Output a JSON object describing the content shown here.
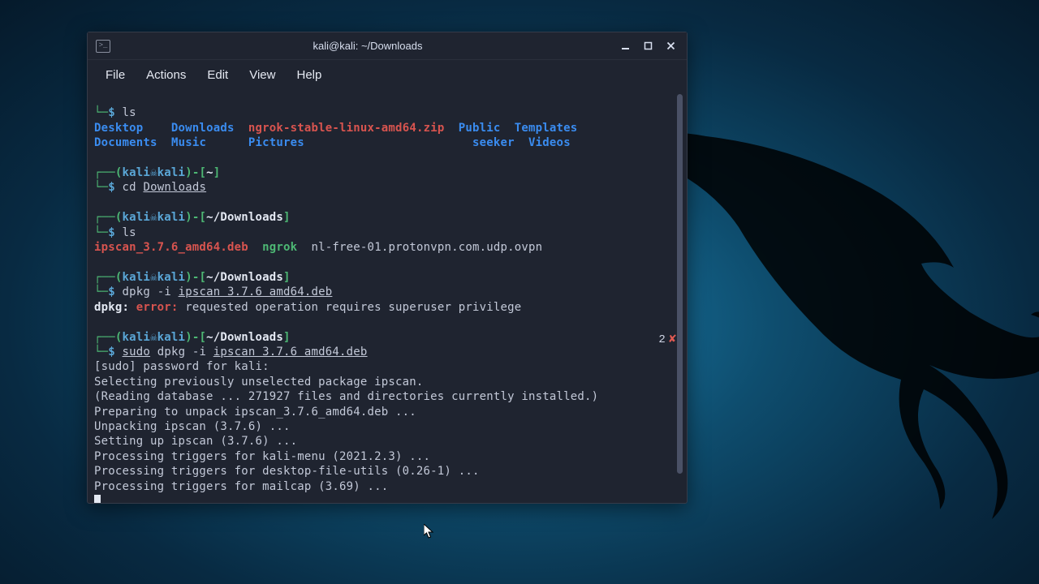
{
  "window": {
    "title": "kali@kali: ~/Downloads",
    "icon_glyph": ">_"
  },
  "menu": {
    "file": "File",
    "actions": "Actions",
    "edit": "Edit",
    "view": "View",
    "help": "Help"
  },
  "prompt": {
    "user": "kali",
    "host": "kali",
    "dollar": "$",
    "skull": "☠"
  },
  "block1": {
    "path": "~",
    "cmd": "ls",
    "listing": {
      "desktop": "Desktop",
      "downloads": "Downloads",
      "zip": "ngrok-stable-linux-amd64.zip",
      "public": "Public",
      "templates": "Templates",
      "documents": "Documents",
      "music": "Music",
      "pictures": "Pictures",
      "seeker": "seeker",
      "videos": "Videos"
    }
  },
  "block2": {
    "path": "~",
    "cmd_cd": "cd ",
    "cmd_arg": "Downloads"
  },
  "block3": {
    "path": "~/Downloads",
    "cmd": "ls",
    "deb": "ipscan_3.7.6_amd64.deb",
    "ngrok": "ngrok",
    "ovpn": "nl-free-01.protonvpn.com.udp.ovpn"
  },
  "block4": {
    "path": "~/Downloads",
    "cmd_prefix": "dpkg -i ",
    "cmd_arg": "ipscan 3.7.6 amd64.deb",
    "err_prefix": "dpkg: ",
    "err_label": "error:",
    "err_msg": " requested operation requires superuser privilege"
  },
  "block5": {
    "path": "~/Downloads",
    "cmd_sudo": "sudo",
    "cmd_middle": " dpkg -i ",
    "cmd_arg": "ipscan 3.7.6 amd64.deb",
    "status_code": "2",
    "status_x": "✘",
    "out1": "[sudo] password for kali: ",
    "out2": "Selecting previously unselected package ipscan.",
    "out3": "(Reading database ... 271927 files and directories currently installed.)",
    "out4": "Preparing to unpack ipscan_3.7.6_amd64.deb ...",
    "out5": "Unpacking ipscan (3.7.6) ...",
    "out6": "Setting up ipscan (3.7.6) ...",
    "out7": "Processing triggers for kali-menu (2021.2.3) ...",
    "out8": "Processing triggers for desktop-file-utils (0.26-1) ...",
    "out9": "Processing triggers for mailcap (3.69) ..."
  }
}
